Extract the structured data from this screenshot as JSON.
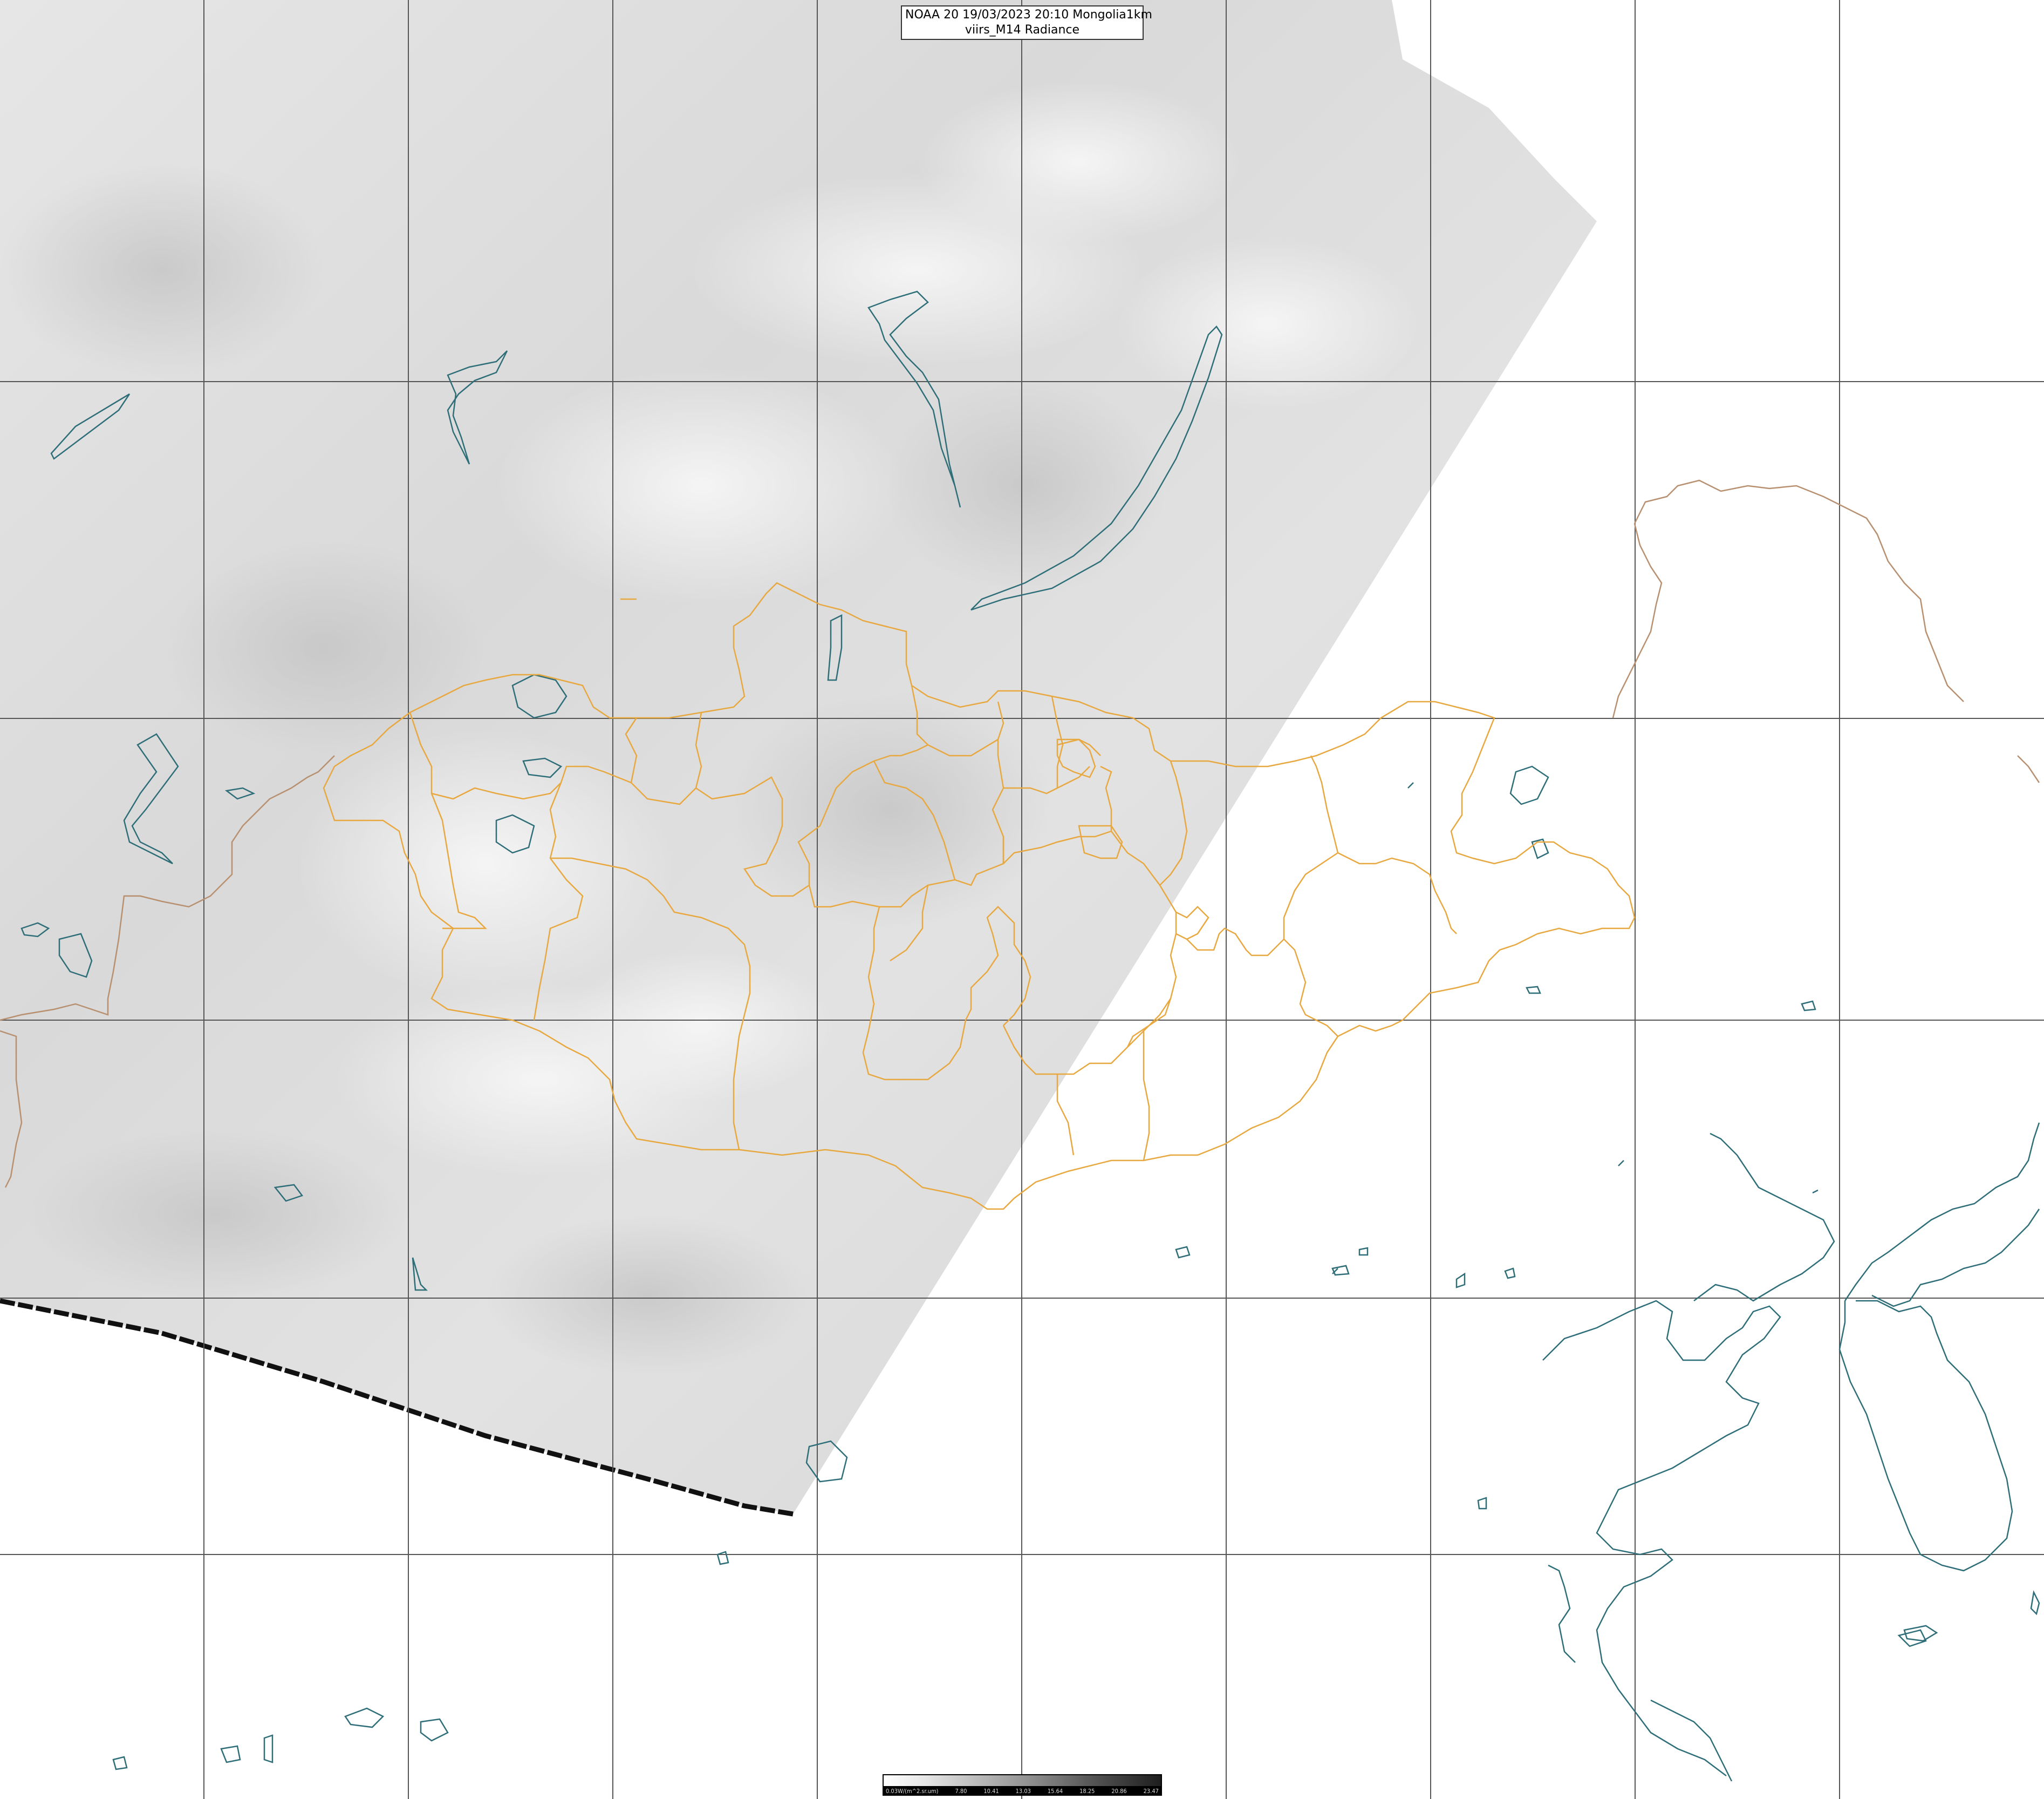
{
  "title": {
    "line1": "NOAA 20 19/03/2023 20:10 Mongolia1km",
    "line2": "viirs_M14 Radiance"
  },
  "legend": {
    "labels": [
      "0.03W/(m^2.sr.um)",
      "7.80",
      "10.41",
      "13.03",
      "15.64",
      "18.25",
      "20.86",
      "23.47"
    ]
  },
  "colors": {
    "background": "#ffffff",
    "swath": "#dcdcdc",
    "grid": "#555555",
    "coastline": "#2e6e78",
    "admin_border": "#e8a840",
    "country_border": "#b89070",
    "swath_edge": "#111111"
  }
}
